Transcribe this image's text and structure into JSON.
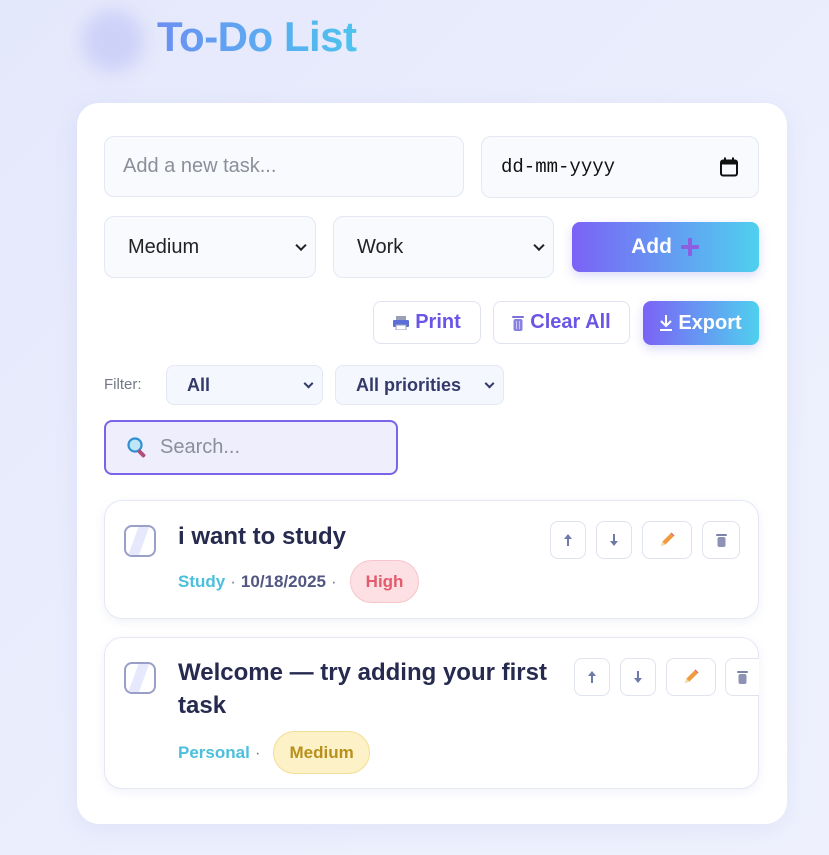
{
  "header": {
    "title": "To-Do List"
  },
  "form": {
    "task_placeholder": "Add a new task...",
    "date_placeholder": "dd-mm-yyyy",
    "priority_value": "Medium",
    "category_value": "Work",
    "add_label": "Add"
  },
  "toolbar": {
    "print_label": "Print",
    "clear_label": "Clear All",
    "export_label": "Export"
  },
  "filters": {
    "label": "Filter:",
    "status_value": "All",
    "priority_value": "All priorities"
  },
  "search": {
    "placeholder": "Search..."
  },
  "tasks": [
    {
      "title": "i want to study",
      "category": "Study",
      "date": "10/18/2025",
      "priority": "High"
    },
    {
      "title_line1": "Welcome — try adding your first",
      "title_line2": "task",
      "category": "Personal",
      "priority": "Medium"
    }
  ],
  "colors": {
    "accent_purple": "#7b62f6",
    "accent_cyan": "#4fd0ee",
    "priority_high": "#e35b6c",
    "priority_medium": "#b8901b",
    "category": "#4cbfdc"
  }
}
